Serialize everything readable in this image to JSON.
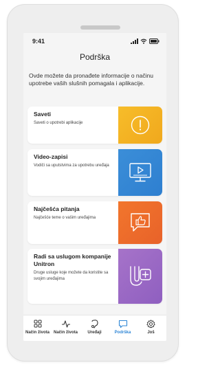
{
  "status_bar": {
    "time": "9:41"
  },
  "page": {
    "title": "Podrška",
    "intro": "Ovde možete da pronađete informacije o načinu upotrebe vaših slušnih pomagala i aplikacije."
  },
  "cards": [
    {
      "title": "Saveti",
      "description": "Saveti o upotrebi aplikacije",
      "icon": "exclamation-circle-icon",
      "color": "#f5b52a"
    },
    {
      "title": "Video-zapisi",
      "description": "Vodiči sa uputstvima za upotrebu uređaja",
      "icon": "video-monitor-icon",
      "color": "#3787d4"
    },
    {
      "title": "Najčešća pitanja",
      "description": "Najčešće teme o vašim uređajima",
      "icon": "thumbs-up-speech-icon",
      "color": "#ee6c2b"
    },
    {
      "title": "Radi sa uslugom kompanije Unitron",
      "description": "Druge usluge koje možete da koristite sa svojim uređajima",
      "icon": "unitron-plus-icon",
      "color": "#9a68c5"
    }
  ],
  "tabs": [
    {
      "label": "Način života",
      "icon": "grid-icon",
      "active": false
    },
    {
      "label": "Način života",
      "icon": "pulse-icon",
      "active": false
    },
    {
      "label": "Uređaji",
      "icon": "hearing-aid-icon",
      "active": false
    },
    {
      "label": "Podrška",
      "icon": "chat-bubble-icon",
      "active": true
    },
    {
      "label": "Još",
      "icon": "gear-icon",
      "active": false
    }
  ],
  "colors": {
    "accent": "#2f86d6",
    "background": "#f5f5f5"
  }
}
